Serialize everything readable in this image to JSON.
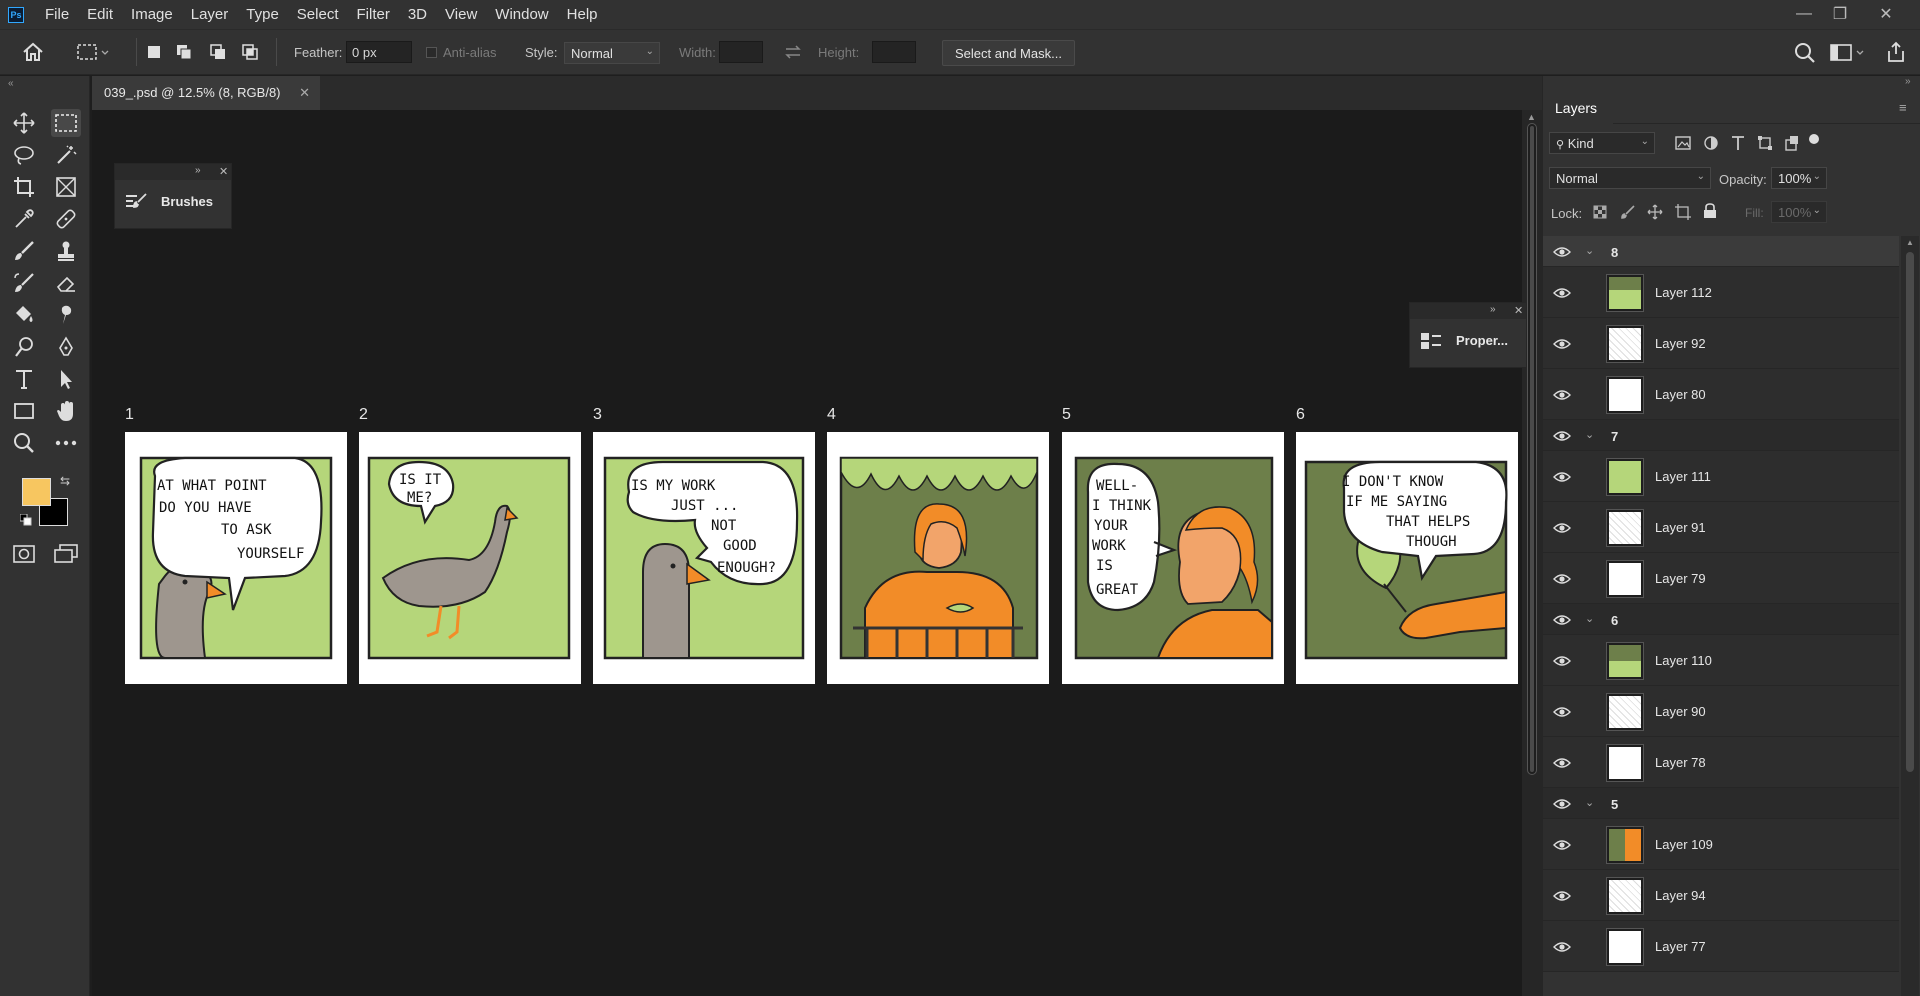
{
  "app": {
    "logo": "Ps"
  },
  "menu": [
    "File",
    "Edit",
    "Image",
    "Layer",
    "Type",
    "Select",
    "Filter",
    "3D",
    "View",
    "Window",
    "Help"
  ],
  "options": {
    "feather_label": "Feather:",
    "feather_value": "0 px",
    "antialias_label": "Anti-alias",
    "style_label": "Style:",
    "style_value": "Normal",
    "width_label": "Width:",
    "height_label": "Height:",
    "select_mask_label": "Select and Mask..."
  },
  "document": {
    "tab_title": "039_.psd @ 12.5% (8, RGB/8)"
  },
  "floating_panels": {
    "brushes_label": "Brushes",
    "properties_label": "Proper..."
  },
  "comic": {
    "panel_numbers": [
      "1",
      "2",
      "3",
      "4",
      "5",
      "6"
    ],
    "panel1_lines": [
      "AT WHAT POINT",
      "DO YOU HAVE",
      "TO ASK",
      "YOURSELF"
    ],
    "panel2_lines": [
      "IS IT",
      "ME?"
    ],
    "panel3_lines": [
      "IS MY WORK",
      "JUST ...",
      "NOT",
      "GOOD",
      "ENOUGH?"
    ],
    "panel5_lines": [
      "WELL-",
      "I THINK",
      "YOUR",
      "WORK",
      "IS",
      "GREAT"
    ],
    "panel6_lines": [
      "I DON'T KNOW",
      "IF ME SAYING",
      "THAT HELPS",
      "THOUGH"
    ],
    "colors": {
      "green": "#b5d67a",
      "dark_green": "#6d7f4a",
      "orange": "#f28c28",
      "goose": "#9e968e"
    }
  },
  "layers_panel": {
    "title": "Layers",
    "filter_kind": "Kind",
    "blend_mode": "Normal",
    "opacity_label": "Opacity:",
    "opacity_value": "100%",
    "lock_label": "Lock:",
    "fill_label": "Fill:",
    "fill_value": "100%",
    "groups": [
      {
        "name": "8",
        "selected": true,
        "layers": [
          "Layer 112",
          "Layer 92",
          "Layer 80"
        ]
      },
      {
        "name": "7",
        "selected": false,
        "layers": [
          "Layer 111",
          "Layer 91",
          "Layer 79"
        ]
      },
      {
        "name": "6",
        "selected": false,
        "layers": [
          "Layer 110",
          "Layer 90",
          "Layer 78"
        ]
      },
      {
        "name": "5",
        "selected": false,
        "layers": [
          "Layer 109",
          "Layer 94",
          "Layer 77"
        ]
      }
    ]
  }
}
